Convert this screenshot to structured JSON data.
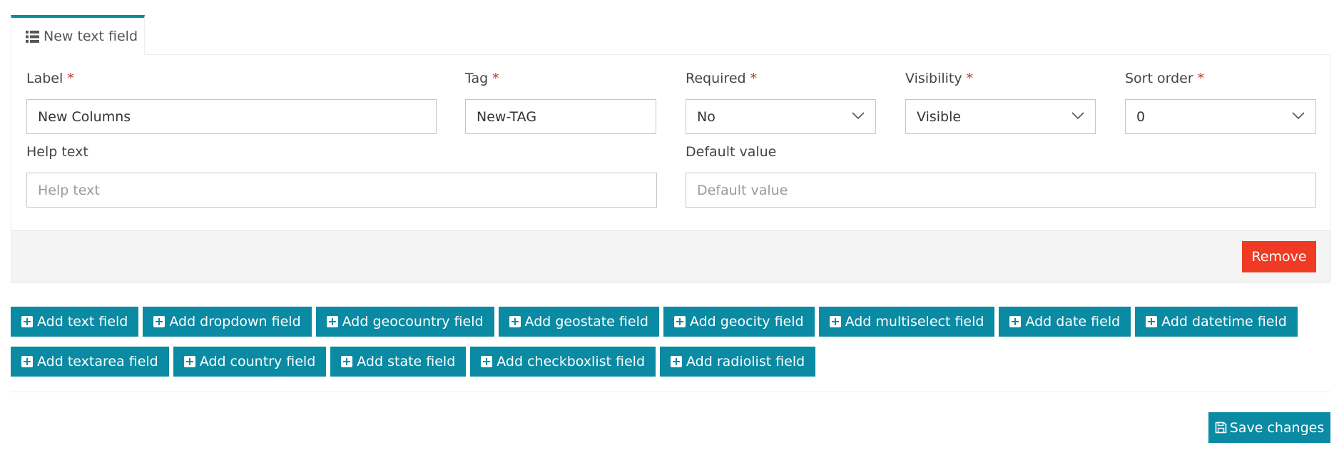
{
  "tab": {
    "label": "New text field",
    "icon": "list-icon"
  },
  "fields": {
    "label": {
      "label": "Label",
      "required_mark": "*",
      "value": "New Columns"
    },
    "tag": {
      "label": "Tag",
      "required_mark": "*",
      "value": "New-TAG"
    },
    "required": {
      "label": "Required",
      "required_mark": "*",
      "value": "No"
    },
    "visibility": {
      "label": "Visibility",
      "required_mark": "*",
      "value": "Visible"
    },
    "sort_order": {
      "label": "Sort order",
      "required_mark": "*",
      "value": "0"
    },
    "help_text": {
      "label": "Help text",
      "placeholder": "Help text",
      "value": ""
    },
    "default_value": {
      "label": "Default value",
      "placeholder": "Default value",
      "value": ""
    }
  },
  "remove_label": "Remove",
  "add_buttons_row1": [
    "Add text field",
    "Add dropdown field",
    "Add geocountry field",
    "Add geostate field",
    "Add geocity field",
    "Add multiselect field",
    "Add date field",
    "Add datetime field"
  ],
  "add_buttons_row2": [
    "Add textarea field",
    "Add country field",
    "Add state field",
    "Add checkboxlist field",
    "Add radiolist field"
  ],
  "save_label": "Save changes",
  "colors": {
    "accent": "#0a8aa3",
    "danger": "#ef3b24",
    "required": "#c0392b"
  }
}
